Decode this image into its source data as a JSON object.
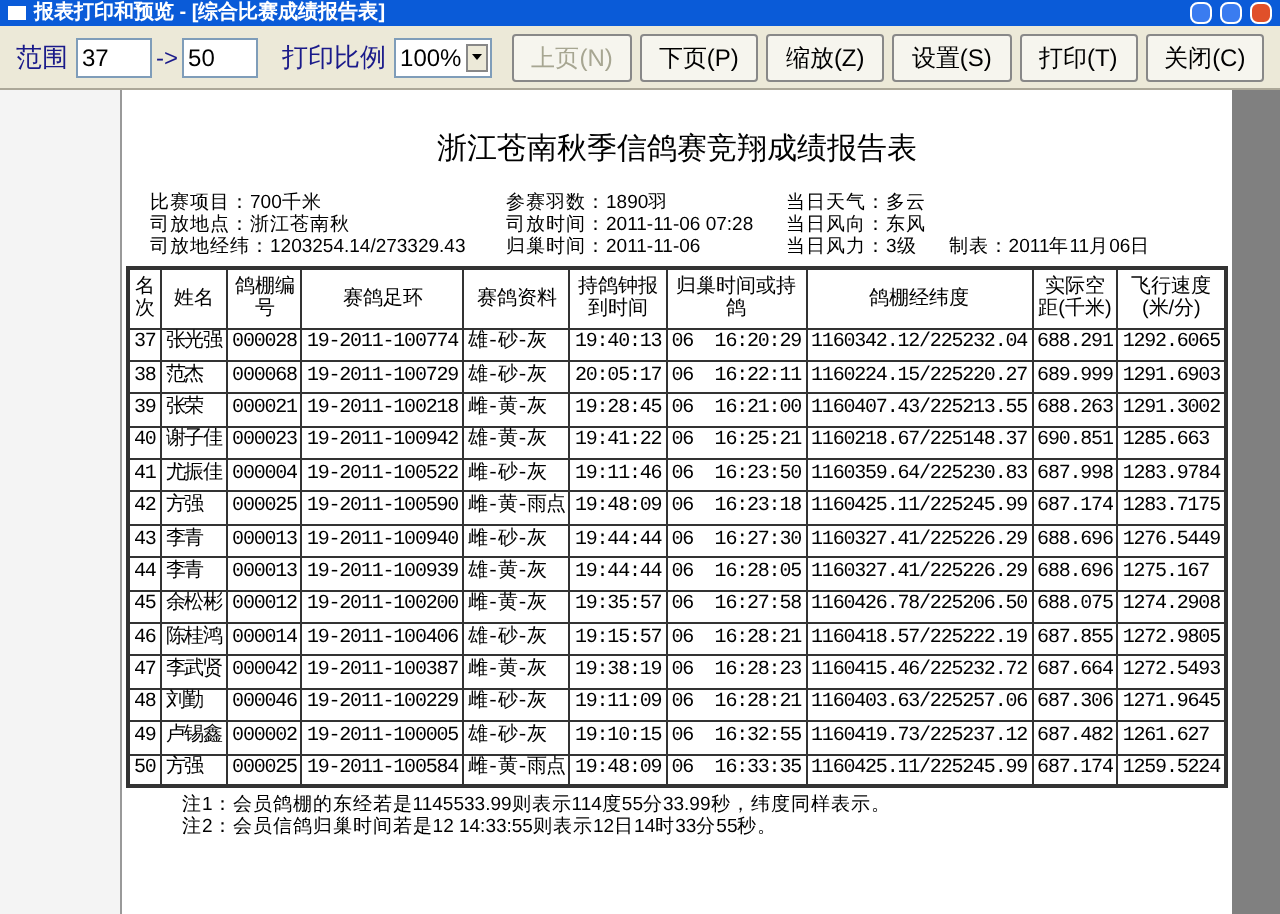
{
  "window": {
    "title": "报表打印和预览 - [综合比赛成绩报告表]"
  },
  "toolbar": {
    "range_label": "范围",
    "range_from": "37",
    "arrow": "->",
    "range_to": "50",
    "scale_label": "打印比例",
    "scale": "100%",
    "buttons": [
      {
        "label": "上页(N)",
        "disabled": true
      },
      {
        "label": "下页(P)",
        "disabled": false
      },
      {
        "label": "缩放(Z)",
        "disabled": false
      },
      {
        "label": "设置(S)",
        "disabled": false
      },
      {
        "label": "打印(T)",
        "disabled": false
      },
      {
        "label": "关闭(C)",
        "disabled": false
      }
    ]
  },
  "report": {
    "title": "浙江苍南秋季信鸽赛竞翔成绩报告表",
    "meta": [
      [
        "比赛项目：700千米",
        "司放地点：浙江苍南秋",
        "司放地经纬：1203254.14/273329.43"
      ],
      [
        "参赛羽数：1890羽",
        "司放时间：2011-11-06 07:28",
        "归巢时间：2011-11-06"
      ],
      [
        "当日天气：多云",
        "当日风向：东风",
        "当日风力：3级"
      ]
    ],
    "made": "制表：2011年11月06日",
    "columns": [
      "名次",
      "姓名",
      "鸽棚编号",
      "赛鸽足环",
      "赛鸽资料",
      "持鸽钟报到时间",
      "归巢时间或持鸽",
      "鸽棚经纬度",
      "实际空距(千米)",
      "飞行速度(米/分)"
    ],
    "rows": [
      [
        "37",
        "张光强",
        "000028",
        "19-2011-100774",
        "雄-砂-灰",
        "19:40:13",
        "06  16:20:29",
        "1160342.12/225232.04",
        "688.291",
        "1292.6065"
      ],
      [
        "38",
        "范杰",
        "000068",
        "19-2011-100729",
        "雄-砂-灰",
        "20:05:17",
        "06  16:22:11",
        "1160224.15/225220.27",
        "689.999",
        "1291.6903"
      ],
      [
        "39",
        "张荣",
        "000021",
        "19-2011-100218",
        "雌-黄-灰",
        "19:28:45",
        "06  16:21:00",
        "1160407.43/225213.55",
        "688.263",
        "1291.3002"
      ],
      [
        "40",
        "谢子佳",
        "000023",
        "19-2011-100942",
        "雄-黄-灰",
        "19:41:22",
        "06  16:25:21",
        "1160218.67/225148.37",
        "690.851",
        "1285.663"
      ],
      [
        "41",
        "尤振佳",
        "000004",
        "19-2011-100522",
        "雌-砂-灰",
        "19:11:46",
        "06  16:23:50",
        "1160359.64/225230.83",
        "687.998",
        "1283.9784"
      ],
      [
        "42",
        "方强",
        "000025",
        "19-2011-100590",
        "雌-黄-雨点",
        "19:48:09",
        "06  16:23:18",
        "1160425.11/225245.99",
        "687.174",
        "1283.7175"
      ],
      [
        "43",
        "李青",
        "000013",
        "19-2011-100940",
        "雌-砂-灰",
        "19:44:44",
        "06  16:27:30",
        "1160327.41/225226.29",
        "688.696",
        "1276.5449"
      ],
      [
        "44",
        "李青",
        "000013",
        "19-2011-100939",
        "雄-黄-灰",
        "19:44:44",
        "06  16:28:05",
        "1160327.41/225226.29",
        "688.696",
        "1275.167"
      ],
      [
        "45",
        "余松彬",
        "000012",
        "19-2011-100200",
        "雌-黄-灰",
        "19:35:57",
        "06  16:27:58",
        "1160426.78/225206.50",
        "688.075",
        "1274.2908"
      ],
      [
        "46",
        "陈桂鸿",
        "000014",
        "19-2011-100406",
        "雄-砂-灰",
        "19:15:57",
        "06  16:28:21",
        "1160418.57/225222.19",
        "687.855",
        "1272.9805"
      ],
      [
        "47",
        "李武贤",
        "000042",
        "19-2011-100387",
        "雌-黄-灰",
        "19:38:19",
        "06  16:28:23",
        "1160415.46/225232.72",
        "687.664",
        "1272.5493"
      ],
      [
        "48",
        "刘勤",
        "000046",
        "19-2011-100229",
        "雌-砂-灰",
        "19:11:09",
        "06  16:28:21",
        "1160403.63/225257.06",
        "687.306",
        "1271.9645"
      ],
      [
        "49",
        "卢锡鑫",
        "000002",
        "19-2011-100005",
        "雄-砂-灰",
        "19:10:15",
        "06  16:32:55",
        "1160419.73/225237.12",
        "687.482",
        "1261.627"
      ],
      [
        "50",
        "方强",
        "000025",
        "19-2011-100584",
        "雌-黄-雨点",
        "19:48:09",
        "06  16:33:35",
        "1160425.11/225245.99",
        "687.174",
        "1259.5224"
      ]
    ],
    "notes": [
      "注1：会员鸽棚的东经若是1145533.99则表示114度55分33.99秒，纬度同样表示。",
      "注2：会员信鸽归巢时间若是12 14:33:55则表示12日14时33分55秒。"
    ]
  }
}
